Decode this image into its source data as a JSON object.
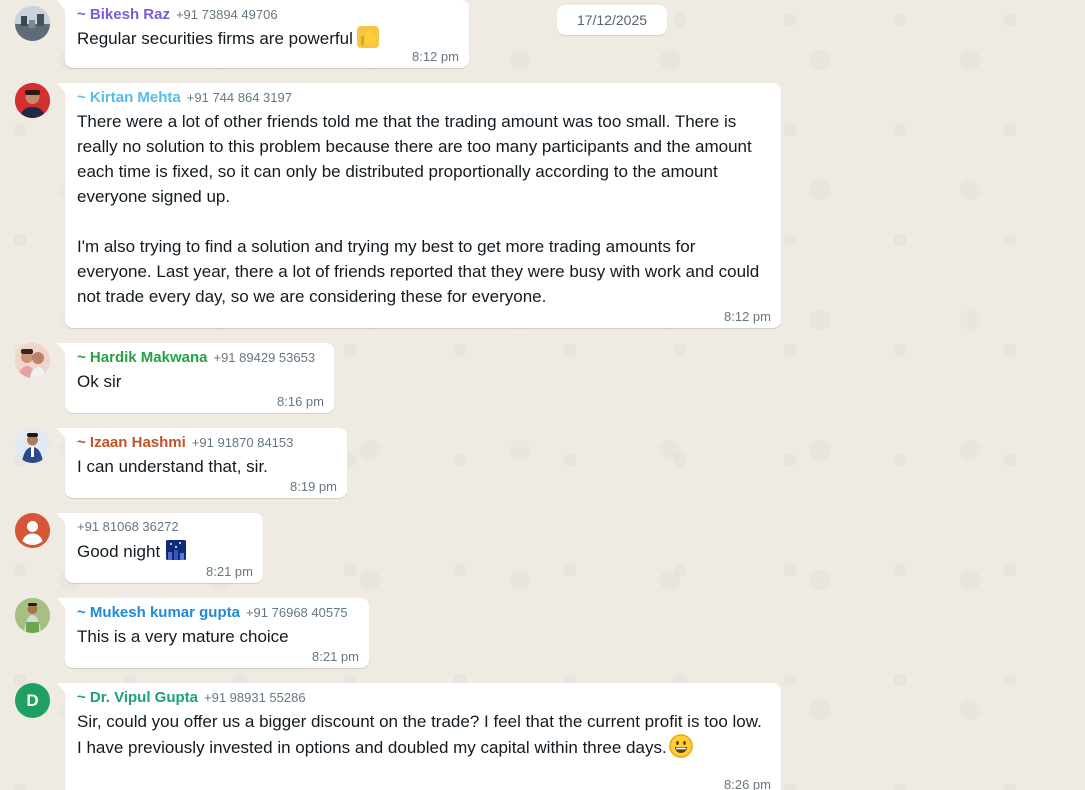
{
  "date_chip": "17/12/2025",
  "colors": {
    "background": "#efeae2",
    "bubble": "#ffffff",
    "timestamp": "#667781"
  },
  "messages": [
    {
      "sender": "~ Bikesh Raz",
      "phone": "+91 73894 49706",
      "name_color": "#7b5cd6",
      "avatar_icon": "profile-photo-icon",
      "text": "Regular securities firms are powerful",
      "emoji": "thumbs-up-emoji",
      "time": "8:12 pm"
    },
    {
      "sender": "~ Kirtan Mehta",
      "phone": "+91 744 864 3197",
      "name_color": "#53bdeb",
      "avatar_icon": "profile-photo-icon",
      "paragraphs": [
        "There were a lot of other friends told me that the trading amount was too small. There is really no solution to this problem because there are too many participants and the amount each time is fixed, so it can only be distributed proportionally according to the amount everyone signed up.",
        "I'm also trying to find a solution and trying my best to get more trading amounts for everyone. Last year, there a lot of friends reported that they were busy with work and could not trade every day, so we are considering these for everyone."
      ],
      "time": "8:12 pm"
    },
    {
      "sender": "~ Hardik Makwana",
      "phone": "+91 89429 53653",
      "name_color": "#25a244",
      "avatar_icon": "profile-photo-icon",
      "text": "Ok sir",
      "time": "8:16 pm"
    },
    {
      "sender": "~ Izaan Hashmi",
      "phone": "+91 91870 84153",
      "name_color": "#c0532b",
      "avatar_icon": "profile-photo-icon",
      "text": "I can understand that, sir.",
      "time": "8:19 pm"
    },
    {
      "sender": "",
      "phone": "+91 81068 36272",
      "name_color": "#667781",
      "avatar_icon": "default-user-icon",
      "text": "Good night",
      "emoji": "night-city-emoji",
      "time": "8:21 pm"
    },
    {
      "sender": "~ Mukesh kumar gupta",
      "phone": "+91 76968 40575",
      "name_color": "#1f8ad8",
      "avatar_icon": "profile-photo-icon",
      "text": "This is a very mature choice",
      "time": "8:21 pm"
    },
    {
      "sender": "~ Dr. Vipul Gupta",
      "phone": "+91 98931 55286",
      "name_color": "#1aa179",
      "avatar_letter": "D",
      "avatar_color": "#20a060",
      "text": "Sir, could you offer us a bigger discount on the trade? I feel that the current profit is too low. I have previously invested in options and doubled my capital within three days.",
      "emoji": "grinning-face-emoji",
      "time": "8:26 pm"
    }
  ]
}
